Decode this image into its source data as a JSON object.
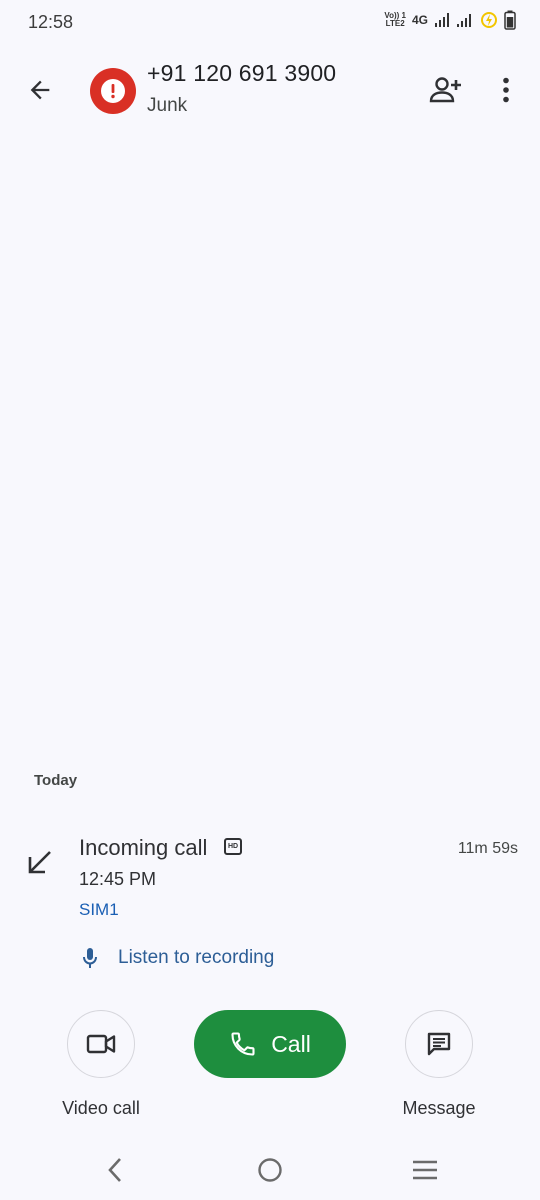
{
  "status_bar": {
    "time": "12:58",
    "volte_line1": "Vo)) 1",
    "volte_line2": "LTE2",
    "network": "4G",
    "icons": [
      "volte-icon",
      "signal-sim1-icon",
      "signal-sim2-icon",
      "battery-saver-icon",
      "battery-icon"
    ]
  },
  "header": {
    "back_icon": "arrow-back-icon",
    "title": "+91 120 691 3900",
    "subtitle": "Junk",
    "avatar_icon": "spam-alert-icon",
    "add_contact_icon": "add-contact-icon",
    "more_icon": "more-vert-icon"
  },
  "history": {
    "section_label": "Today",
    "entries": [
      {
        "type": "Incoming call",
        "badge": "HD",
        "time": "12:45 PM",
        "sim": "SIM1",
        "duration": "11m 59s",
        "icon": "incoming-call-icon"
      }
    ],
    "recording_label": "Listen to recording"
  },
  "actions": {
    "video_label": "Video call",
    "call_label": "Call",
    "message_label": "Message"
  },
  "nav": {
    "back_icon": "nav-back-icon",
    "home_icon": "nav-home-icon",
    "recents_icon": "nav-recents-icon"
  },
  "colors": {
    "background": "#f8f8fd",
    "danger": "#d93025",
    "call_green": "#1e8e3e",
    "link_blue": "#1a5fb4",
    "battery_saver": "#f2c500"
  }
}
